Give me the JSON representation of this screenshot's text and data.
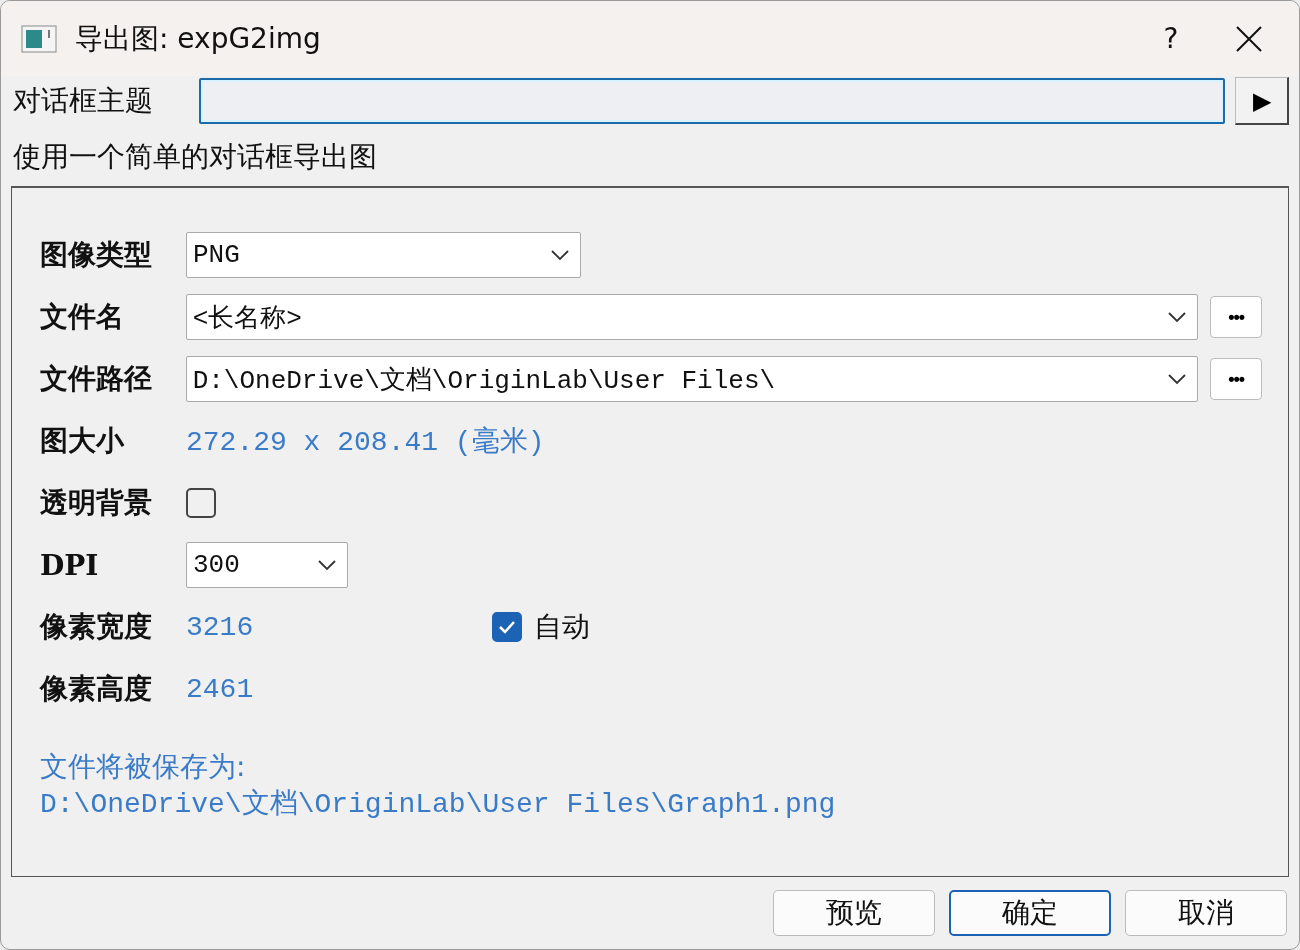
{
  "window": {
    "title": "导出图: expG2img",
    "help": "?"
  },
  "theme": {
    "label": "对话框主题",
    "run": "▶"
  },
  "description": "使用一个简单的对话框导出图",
  "form": [
    {
      "kind": "select",
      "label": "图像类型",
      "value": "PNG"
    },
    {
      "kind": "browse_select",
      "label": "文件名",
      "value": "<长名称>",
      "browse": "•••"
    },
    {
      "kind": "browse_select",
      "label": "文件路径",
      "value": "D:\\OneDrive\\文档\\OriginLab\\User Files\\",
      "browse": "•••"
    },
    {
      "kind": "info",
      "label": "图大小",
      "value": "272.29 x 208.41 (毫米)"
    },
    {
      "kind": "checkbox",
      "label": "透明背景",
      "checked": false
    },
    {
      "kind": "short_select",
      "label": "DPI",
      "value": "300"
    },
    {
      "kind": "info_check",
      "label": "像素宽度",
      "value": "3216",
      "check_label": "自动",
      "checked": true
    },
    {
      "kind": "info",
      "label": "像素高度",
      "value": "2461"
    }
  ],
  "saved": {
    "label": "文件将被保存为:",
    "path": "D:\\OneDrive\\文档\\OriginLab\\User Files\\Graph1.png"
  },
  "buttons": [
    {
      "label": "预览",
      "default": false
    },
    {
      "label": "确定",
      "default": true
    },
    {
      "label": "取消",
      "default": false
    }
  ]
}
